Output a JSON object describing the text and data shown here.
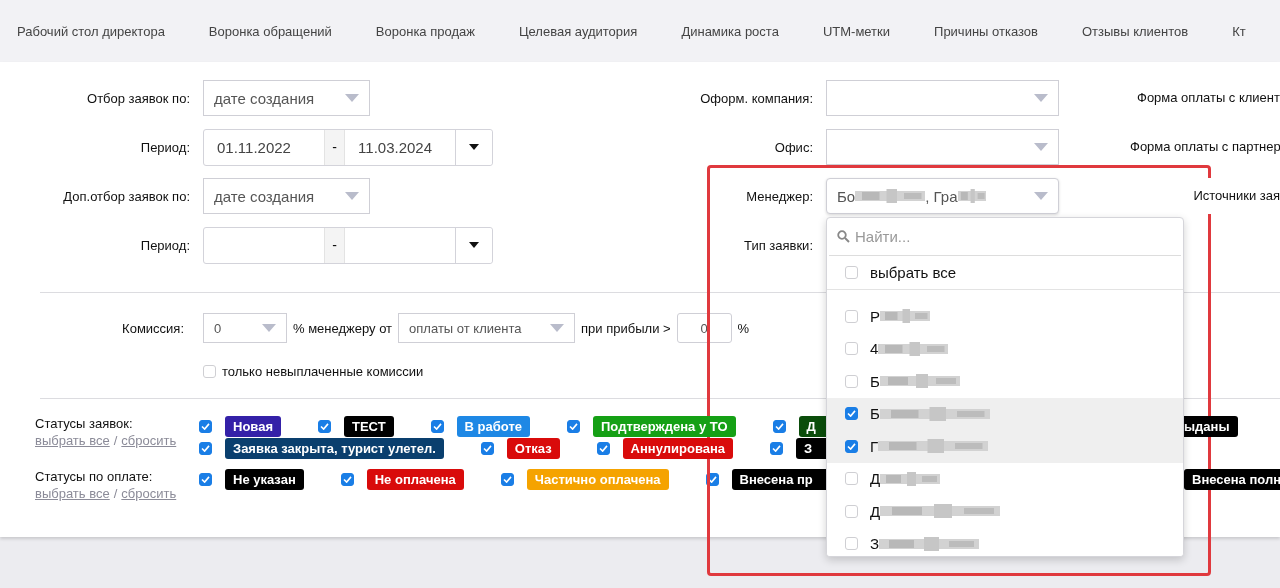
{
  "nav_tabs": [
    {
      "label": "Рабочий стол директора"
    },
    {
      "label": "Воронка обращений"
    },
    {
      "label": "Воронка продаж"
    },
    {
      "label": "Целевая аудитория"
    },
    {
      "label": "Динамика роста"
    },
    {
      "label": "UTM-метки"
    },
    {
      "label": "Причины отказов"
    },
    {
      "label": "Отзывы клиентов"
    },
    {
      "label": "Кт"
    }
  ],
  "filters_left": [
    {
      "label": "Отбор заявок по:",
      "kind": "select",
      "value": "дате создания"
    },
    {
      "label": "Период:",
      "kind": "period",
      "from": "01.11.2022",
      "separator": "-",
      "to": "11.03.2024"
    },
    {
      "label": "Доп.отбор заявок по:",
      "kind": "select",
      "value": "дате создания"
    },
    {
      "label": "Период:",
      "kind": "period",
      "separator": "-"
    }
  ],
  "filters_middle": [
    {
      "label": "Оформ. компания:",
      "kind": "select"
    },
    {
      "label": "Офис:",
      "kind": "select"
    },
    {
      "label": "Менеджер:",
      "kind": "multiselect",
      "value_parts": [
        "Бо",
        ", Гра"
      ]
    },
    {
      "label": "Тип заявки:",
      "kind": "label"
    }
  ],
  "filters_right": [
    {
      "label": "Форма оплаты с клиент"
    },
    {
      "label": "Форма оплаты с партнер"
    },
    {
      "label": "Источники зая"
    }
  ],
  "commission": {
    "label": "Комиссия:",
    "percent": "0",
    "text_1": "% менеджеру от",
    "base": "оплаты от клиента",
    "text_2": "при прибыли >",
    "threshold": "0",
    "text_3": "%",
    "unpaid_only": {
      "label": "только невыплаченные комиссии",
      "checked": false
    }
  },
  "status_groups": [
    {
      "label": "Статусы заявок:",
      "select_all": "выбрать все",
      "separator": "/",
      "reset": "сбросить",
      "rows": [
        {
          "items": [
            {
              "text": "Новая",
              "color": "#3421a8",
              "checked": true
            },
            {
              "text": "ТЕСТ",
              "color": "#000000",
              "checked": true
            },
            {
              "text": "В работе",
              "color": "#1e88e5",
              "checked": true
            },
            {
              "text": "Подтверждена у ТО",
              "color": "#15a015",
              "checked": true
            },
            {
              "text": "Д",
              "color": "#0b4d0b",
              "checked": true
            }
          ],
          "right_items": [
            {
              "text": "ыданы",
              "color": "#000000"
            }
          ]
        },
        {
          "items": [
            {
              "text": "Заявка закрыта, турист улетел.",
              "color": "#0a3f6e",
              "checked": true
            },
            {
              "text": "Отказ",
              "color": "#d90b0b",
              "checked": true
            },
            {
              "text": "Аннулирована",
              "color": "#d90b0b",
              "checked": true
            },
            {
              "text": "З",
              "color": "#000000",
              "checked": true
            }
          ]
        }
      ]
    },
    {
      "label": "Статусы по оплате:",
      "select_all": "выбрать все",
      "separator": "/",
      "reset": "сбросить",
      "rows": [
        {
          "items": [
            {
              "text": "Не указан",
              "color": "#000000",
              "checked": true
            },
            {
              "text": "Не оплачена",
              "color": "#d90b0b",
              "checked": true
            },
            {
              "text": "Частично оплачена",
              "color": "#f5a300",
              "checked": true
            },
            {
              "text": "Внесена пр",
              "color": "#000000",
              "checked": true
            }
          ],
          "right_items": [
            {
              "text": "Внесена полн",
              "color": "#000000"
            }
          ]
        }
      ]
    }
  ],
  "manager_dropdown": {
    "placeholder": "Найти...",
    "select_all": {
      "label": "выбрать все",
      "checked": false
    },
    "options": [
      {
        "text": "Р",
        "checked": false
      },
      {
        "text": "4",
        "checked": false
      },
      {
        "text": "Б",
        "checked": false
      },
      {
        "text": "Б",
        "checked": true
      },
      {
        "text": "Г",
        "checked": true
      },
      {
        "text": "Д",
        "checked": false
      },
      {
        "text": "Д",
        "checked": false
      },
      {
        "text": "З",
        "checked": false
      }
    ]
  }
}
